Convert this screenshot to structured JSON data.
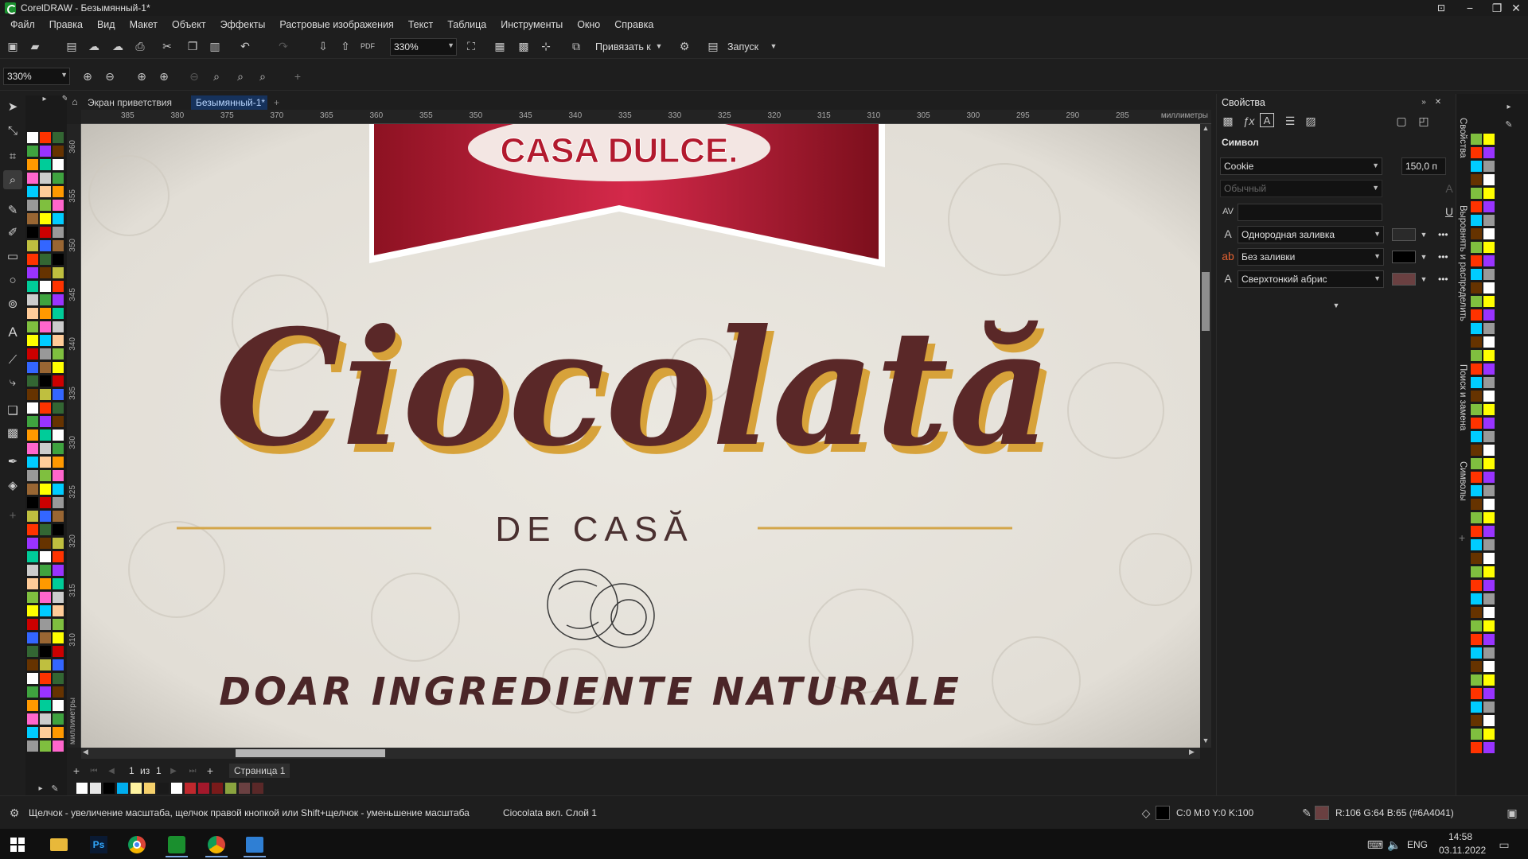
{
  "window": {
    "title": "CorelDRAW - Безымянный-1*",
    "controls": [
      "−",
      "❐",
      "✕"
    ]
  },
  "menu": [
    "Файл",
    "Правка",
    "Вид",
    "Макет",
    "Объект",
    "Эффекты",
    "Растровые изображения",
    "Текст",
    "Таблица",
    "Инструменты",
    "Окно",
    "Справка"
  ],
  "toolbar1": {
    "zoom_value": "330%",
    "snap_label": "Привязать к",
    "launch_label": "Запуск"
  },
  "toolbar2": {
    "zoom_value": "330%"
  },
  "tabs": {
    "welcome": "Экран приветствия",
    "document": "Безымянный-1*",
    "add": "+"
  },
  "ruler": {
    "unit": "миллиметры",
    "top_ticks": [
      "385",
      "380",
      "375",
      "370",
      "365",
      "360",
      "355",
      "350",
      "345",
      "340",
      "335",
      "330",
      "325",
      "320",
      "315",
      "310",
      "305",
      "300",
      "295",
      "290",
      "285"
    ],
    "left_ticks": [
      "360",
      "355",
      "350",
      "345",
      "340",
      "335",
      "330",
      "325",
      "320",
      "315",
      "310"
    ]
  },
  "artwork": {
    "brand": "CASA DULCE.",
    "headline": "Ciocolată",
    "subtitle": "DE CASĂ",
    "tagline": "DOAR INGREDIENTE NATURALE"
  },
  "pagenav": {
    "current": "1",
    "of_label": "из",
    "total": "1",
    "page_tab": "Страница 1"
  },
  "docker": {
    "title": "Свойства",
    "section": "Символ",
    "font_name": "Cookie",
    "font_size": "150,0 п",
    "font_style": "Обычный",
    "kerning_value": "",
    "fill_type": "Однородная заливка",
    "bg_fill_type": "Без заливки",
    "outline_type": "Сверхтонкий абрис",
    "more": "•••",
    "fill_color": "#2a2a2a",
    "bg_fill_color": "#000000",
    "outline_color": "#6a4041",
    "vertical_tabs": [
      "Свойства",
      "Выровнять и распределить",
      "Поиск и замена",
      "Символы"
    ]
  },
  "status": {
    "hint": "Щелчок - увеличение масштаба, щелчок правой кнопкой или Shift+щелчок - уменьшение масштаба",
    "object_info": "Ciocolata вкл. Слой 1",
    "fill_info": "C:0 M:0 Y:0 K:100",
    "outline_info": "R:106 G:64 B:65 (#6A4041)"
  },
  "taskbar": {
    "lang": "ENG",
    "time": "14:58",
    "date": "03.11.2022"
  },
  "colors": {
    "headline": "#5a2828",
    "headline_shadow": "#d7a23a",
    "banner": "#a3182b",
    "canvas_bg": "#e8e4dc"
  }
}
